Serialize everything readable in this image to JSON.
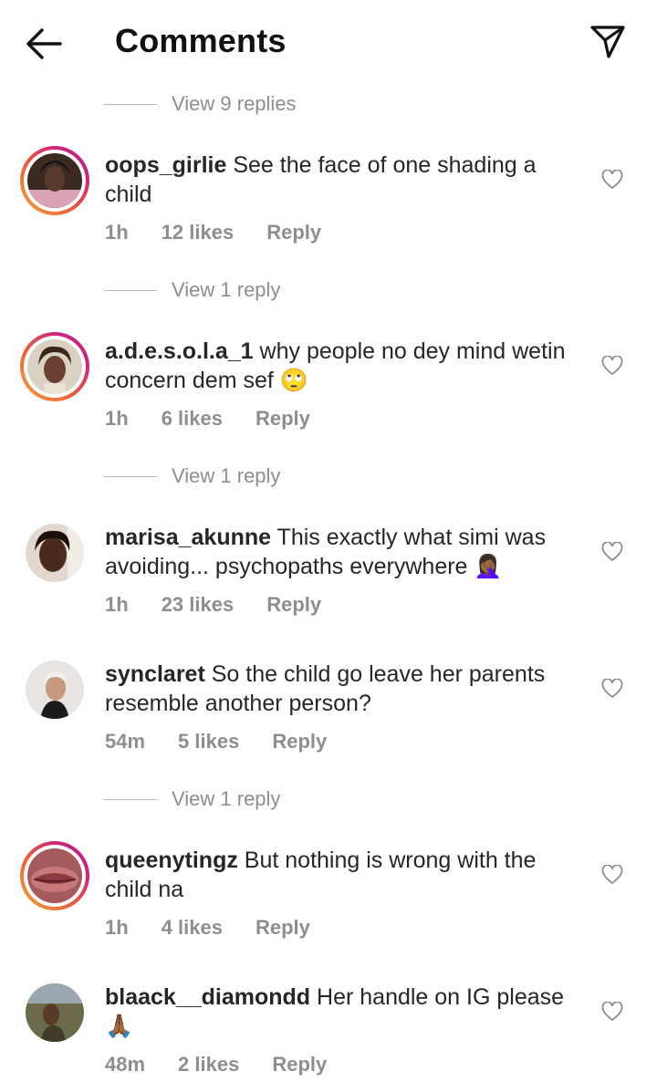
{
  "header": {
    "title": "Comments"
  },
  "view_replies_top": "View 9 replies",
  "comments": [
    {
      "user": "oops_girlie",
      "text": "See the face of one shading a child",
      "time": "1h",
      "likes": "12 likes",
      "reply": "Reply",
      "view_replies": "View 1 reply"
    },
    {
      "user": "a.d.e.s.o.l.a_1",
      "text": "why people no dey mind wetin concern dem sef 🙄",
      "time": "1h",
      "likes": "6 likes",
      "reply": "Reply",
      "view_replies": "View 1 reply"
    },
    {
      "user": "marisa_akunne",
      "text": "This exactly what simi was avoiding... psychopaths everywhere 🤦🏾‍♀️",
      "time": "1h",
      "likes": "23 likes",
      "reply": "Reply"
    },
    {
      "user": "synclaret",
      "text": "So the child go leave her parents resemble another person?",
      "time": "54m",
      "likes": "5 likes",
      "reply": "Reply",
      "view_replies": "View 1 reply"
    },
    {
      "user": "queenytingz",
      "text": "But nothing is wrong with the child na",
      "time": "1h",
      "likes": "4 likes",
      "reply": "Reply"
    },
    {
      "user": "blaack__diamondd",
      "text": "Her handle on IG please 🙏🏾",
      "time": "48m",
      "likes": "2 likes",
      "reply": "Reply"
    }
  ]
}
